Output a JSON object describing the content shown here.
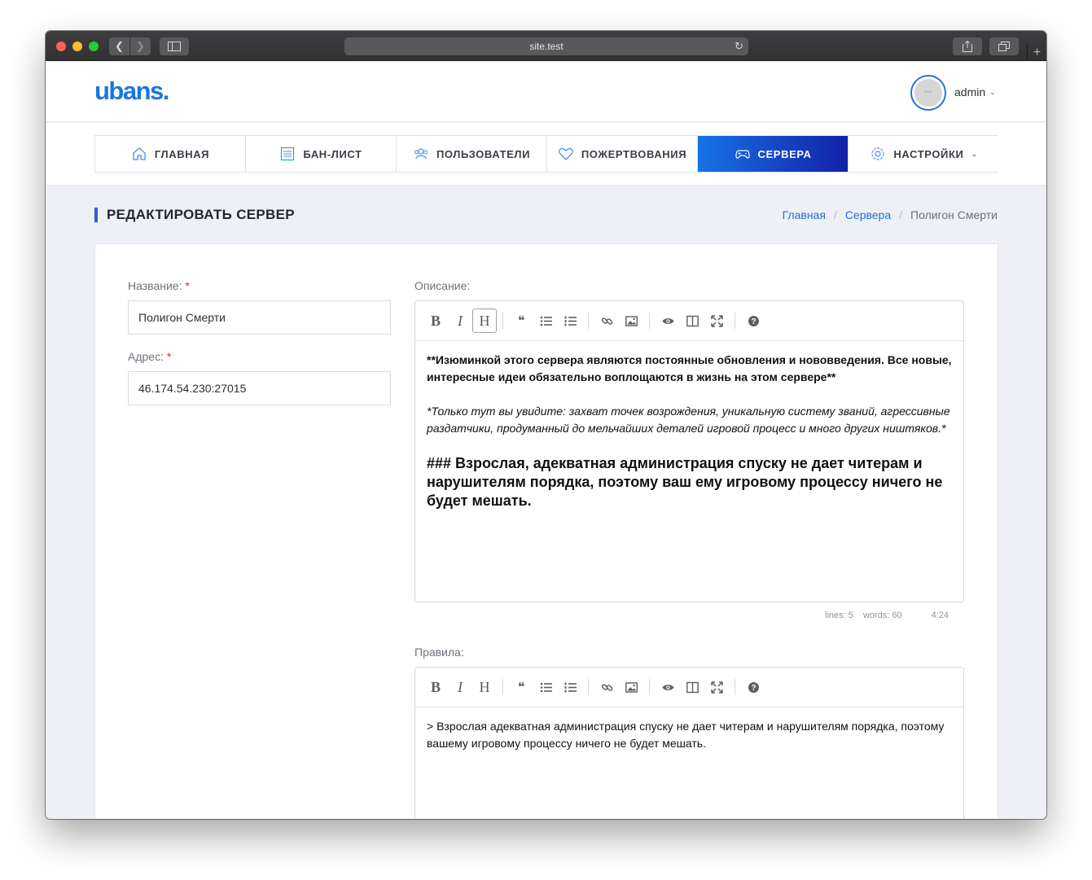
{
  "browser": {
    "url": "site.test",
    "new_tab_glyph": "+"
  },
  "header": {
    "logo": "ubans.",
    "username": "admin"
  },
  "nav": {
    "items": [
      {
        "label": "ГЛАВНАЯ",
        "icon": "home-icon"
      },
      {
        "label": "БАН-ЛИСТ",
        "icon": "list-icon"
      },
      {
        "label": "ПОЛЬЗОВАТЕЛИ",
        "icon": "users-icon"
      },
      {
        "label": "ПОЖЕРТВОВАНИЯ",
        "icon": "heart-icon"
      },
      {
        "label": "СЕРВЕРА",
        "icon": "gamepad-icon",
        "active": true
      },
      {
        "label": "НАСТРОЙКИ",
        "icon": "gear-icon"
      }
    ],
    "active_color_start": "#1772e6",
    "active_color_end": "#1321a8"
  },
  "page": {
    "title": "РЕДАКТИРОВАТЬ СЕРВЕР",
    "breadcrumb": [
      "Главная",
      "Сервера",
      "Полигон Смерти"
    ]
  },
  "form": {
    "name_label": "Название:",
    "name_value": "Полигон Смерти",
    "address_label": "Адрес:",
    "address_value": "46.174.54.230:27015",
    "required_mark": "*",
    "description_label": "Описание:",
    "description": {
      "bold": "**Изюминкой этого сервера являются постоянные обновления и нововведения. Все новые, интересные идеи обязательно воплощаются в жизнь на этом сервере**",
      "italic": "*Только тут вы увидите: захват точек возрождения, уникальную систему званий, агрессивные раздатчики, продуманный до мельчайших деталей игровой процесс и много других ништяков.*",
      "heading": "### Взрослая, адекватная администрация спуску не дает читерам и нарушителям порядка, поэтому ваш ему игровому процессу ничего не будет мешать."
    },
    "description_status": {
      "lines": "lines: 5",
      "words": "words: 60",
      "cursor": "4:24"
    },
    "rules_label": "Правила:",
    "rules_text": "> Взрослая адекватная администрация спуску не дает читерам и нарушителям порядка, поэтому вашему игровому процессу ничего не будет мешать."
  },
  "editor_tools": {
    "bold": "B",
    "italic": "I",
    "heading": "H"
  }
}
